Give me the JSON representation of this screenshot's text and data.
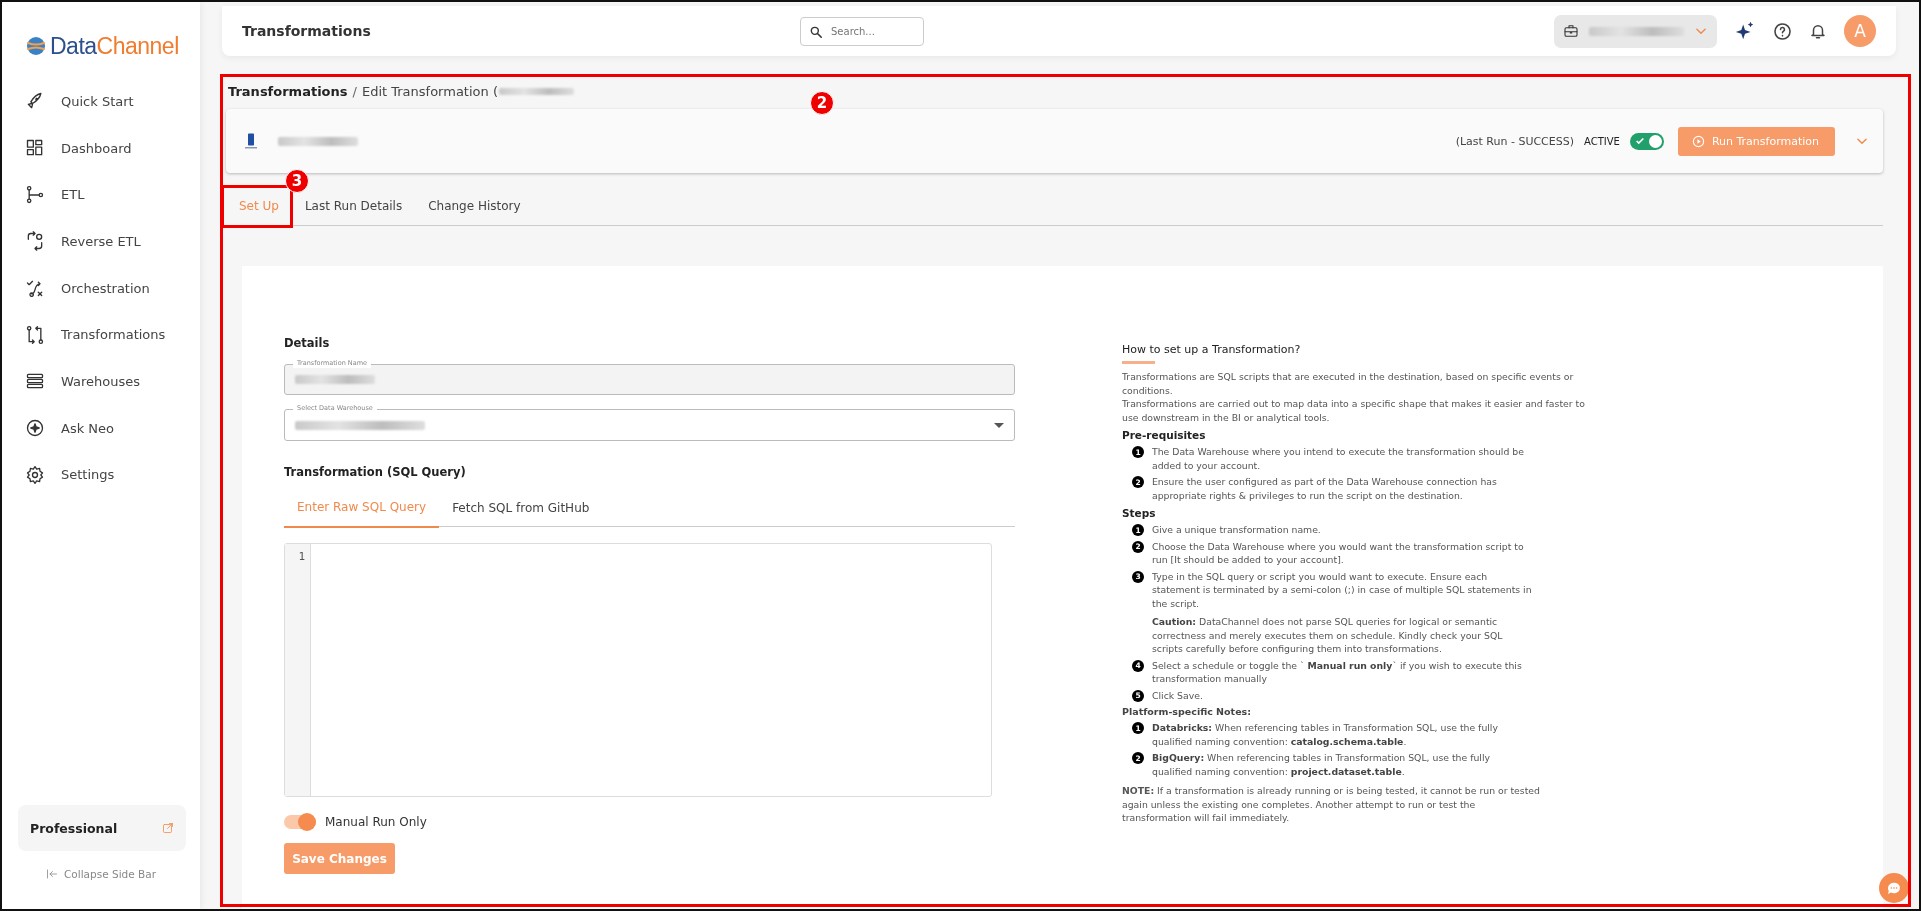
{
  "sidebar": {
    "logo": {
      "first": "Data",
      "second": "Channel"
    },
    "items": [
      {
        "label": "Quick Start",
        "selected": false
      },
      {
        "label": "Dashboard",
        "selected": false
      },
      {
        "label": "ETL",
        "selected": false
      },
      {
        "label": "Reverse ETL",
        "selected": false
      },
      {
        "label": "Orchestration",
        "selected": false
      },
      {
        "label": "Transformations",
        "selected": false
      },
      {
        "label": "Warehouses",
        "selected": false
      },
      {
        "label": "Ask Neo",
        "selected": false
      },
      {
        "label": "Settings",
        "selected": false
      }
    ],
    "plan": "Professional",
    "collapse": "Collapse Side Bar"
  },
  "top_bar": {
    "title": "Transformations",
    "search": {
      "placeholder": "Search..."
    },
    "avatar": "A"
  },
  "breadcrumb": {
    "parent": "Transformations",
    "separator": "/",
    "current": "Edit Transformation ("
  },
  "header": {
    "status": "(Last Run - SUCCESS)",
    "active_label": "ACTIVE",
    "active": true,
    "run_button": "Run Transformation"
  },
  "tabs": [
    {
      "label": "Set Up",
      "selected": true
    },
    {
      "label": "Last Run Details",
      "selected": false
    },
    {
      "label": "Change History",
      "selected": false
    }
  ],
  "details": {
    "heading": "Details",
    "name_label": "Transformation Name",
    "warehouse_label": "Select Data Warehouse"
  },
  "sql": {
    "heading": "Transformation (SQL Query)",
    "tabs": [
      {
        "label": "Enter Raw SQL Query",
        "selected": true
      },
      {
        "label": "Fetch SQL from GitHub",
        "selected": false
      }
    ],
    "line_numbers": [
      "1"
    ]
  },
  "manual_run": {
    "label": "Manual Run Only",
    "on": true
  },
  "save_button": "Save Changes",
  "help": {
    "title": "How to set up a Transformation?",
    "intro": [
      "Transformations are SQL scripts that are executed in the destination, based on specific events or conditions.",
      "Transformations are carried out to map data into a specific shape that makes it easier and faster to use downstream in the BI or analytical tools."
    ],
    "sections": [
      {
        "heading": "Pre-requisites",
        "kind": "major",
        "items": [
          {
            "n": "1",
            "text": "The Data Warehouse where you intend to execute the transformation should be added to your account."
          },
          {
            "n": "2",
            "text": "Ensure the user configured as part of the Data Warehouse connection has appropriate rights & privileges to run the script on the destination."
          }
        ]
      },
      {
        "heading": "Steps",
        "kind": "major",
        "items": [
          {
            "n": "1",
            "text": "Give a unique transformation name."
          },
          {
            "n": "2",
            "text": "Choose the Data Warehouse where you would want the transformation script to run [It should be added to your account]."
          },
          {
            "n": "3",
            "text": "Type in the SQL query or script you would want to execute. Ensure each statement is terminated by a semi-colon (;) in case of multiple SQL statements in the script.",
            "note": "**Caution:** DataChannel does not parse SQL queries for logical or semantic correctness and merely executes them on schedule. Kindly check your SQL scripts carefully before configuring them into transformations."
          },
          {
            "n": "4",
            "text": "Select a schedule or toggle the ` **Manual run only**` if you wish to execute this transformation manually"
          },
          {
            "n": "5",
            "text": "Click Save."
          }
        ]
      },
      {
        "heading": "Platform-specific Notes:",
        "kind": "minor",
        "items": [
          {
            "n": "1",
            "text": "**Databricks:** When referencing tables in Transformation SQL, use the fully qualified naming convention: **catalog.schema.table**."
          },
          {
            "n": "2",
            "text": "**BigQuery:** When referencing tables in Transformation SQL, use the fully qualified naming convention: **project.dataset.table**."
          }
        ]
      }
    ],
    "note": "**NOTE:** If a transformation is already running or is being tested, it cannot be run or tested again unless the existing one completes. Another attempt to run or test the transformation will fail immediately."
  },
  "annotations": [
    {
      "label": "2"
    },
    {
      "label": "3"
    }
  ]
}
